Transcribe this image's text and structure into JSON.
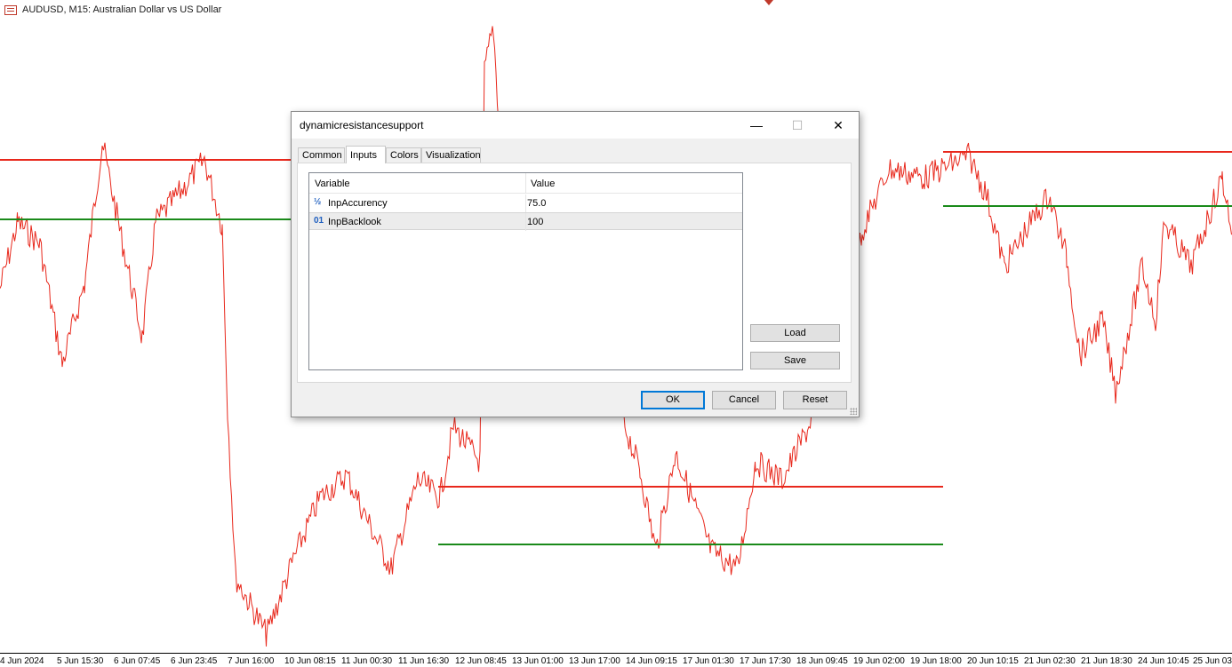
{
  "chart": {
    "symbol_title": "AUDUSD, M15:  Australian Dollar vs US Dollar",
    "candle_color": "#e8281c",
    "resistance_color": "#e8281c",
    "support_color": "#1a8a1a",
    "x_ticks": [
      "4 Jun 2024",
      "5 Jun 15:30",
      "6 Jun 07:45",
      "6 Jun 23:45",
      "7 Jun 16:00",
      "10 Jun 08:15",
      "11 Jun 00:30",
      "11 Jun 16:30",
      "12 Jun 08:45",
      "13 Jun 01:00",
      "13 Jun 17:00",
      "14 Jun 09:15",
      "17 Jun 01:30",
      "17 Jun 17:30",
      "18 Jun 09:45",
      "19 Jun 02:00",
      "19 Jun 18:00",
      "20 Jun 10:15",
      "21 Jun 02:30",
      "21 Jun 18:30",
      "24 Jun 10:45",
      "25 Jun 03:00"
    ]
  },
  "dialog": {
    "title": "dynamicresistancesupport",
    "window_controls": {
      "minimize": "—",
      "maximize": "☐",
      "close": "✕"
    },
    "tabs": [
      {
        "label": "Common",
        "active": false
      },
      {
        "label": "Inputs",
        "active": true
      },
      {
        "label": "Colors",
        "active": false
      },
      {
        "label": "Visualization",
        "active": false
      }
    ],
    "grid": {
      "headers": {
        "variable": "Variable",
        "value": "Value"
      },
      "rows": [
        {
          "type_icon": "½",
          "variable": "InpAccurency",
          "value": "75.0"
        },
        {
          "type_icon": "01",
          "variable": "InpBacklook",
          "value": "100"
        }
      ]
    },
    "buttons": {
      "load": "Load",
      "save": "Save",
      "ok": "OK",
      "cancel": "Cancel",
      "reset": "Reset"
    }
  }
}
